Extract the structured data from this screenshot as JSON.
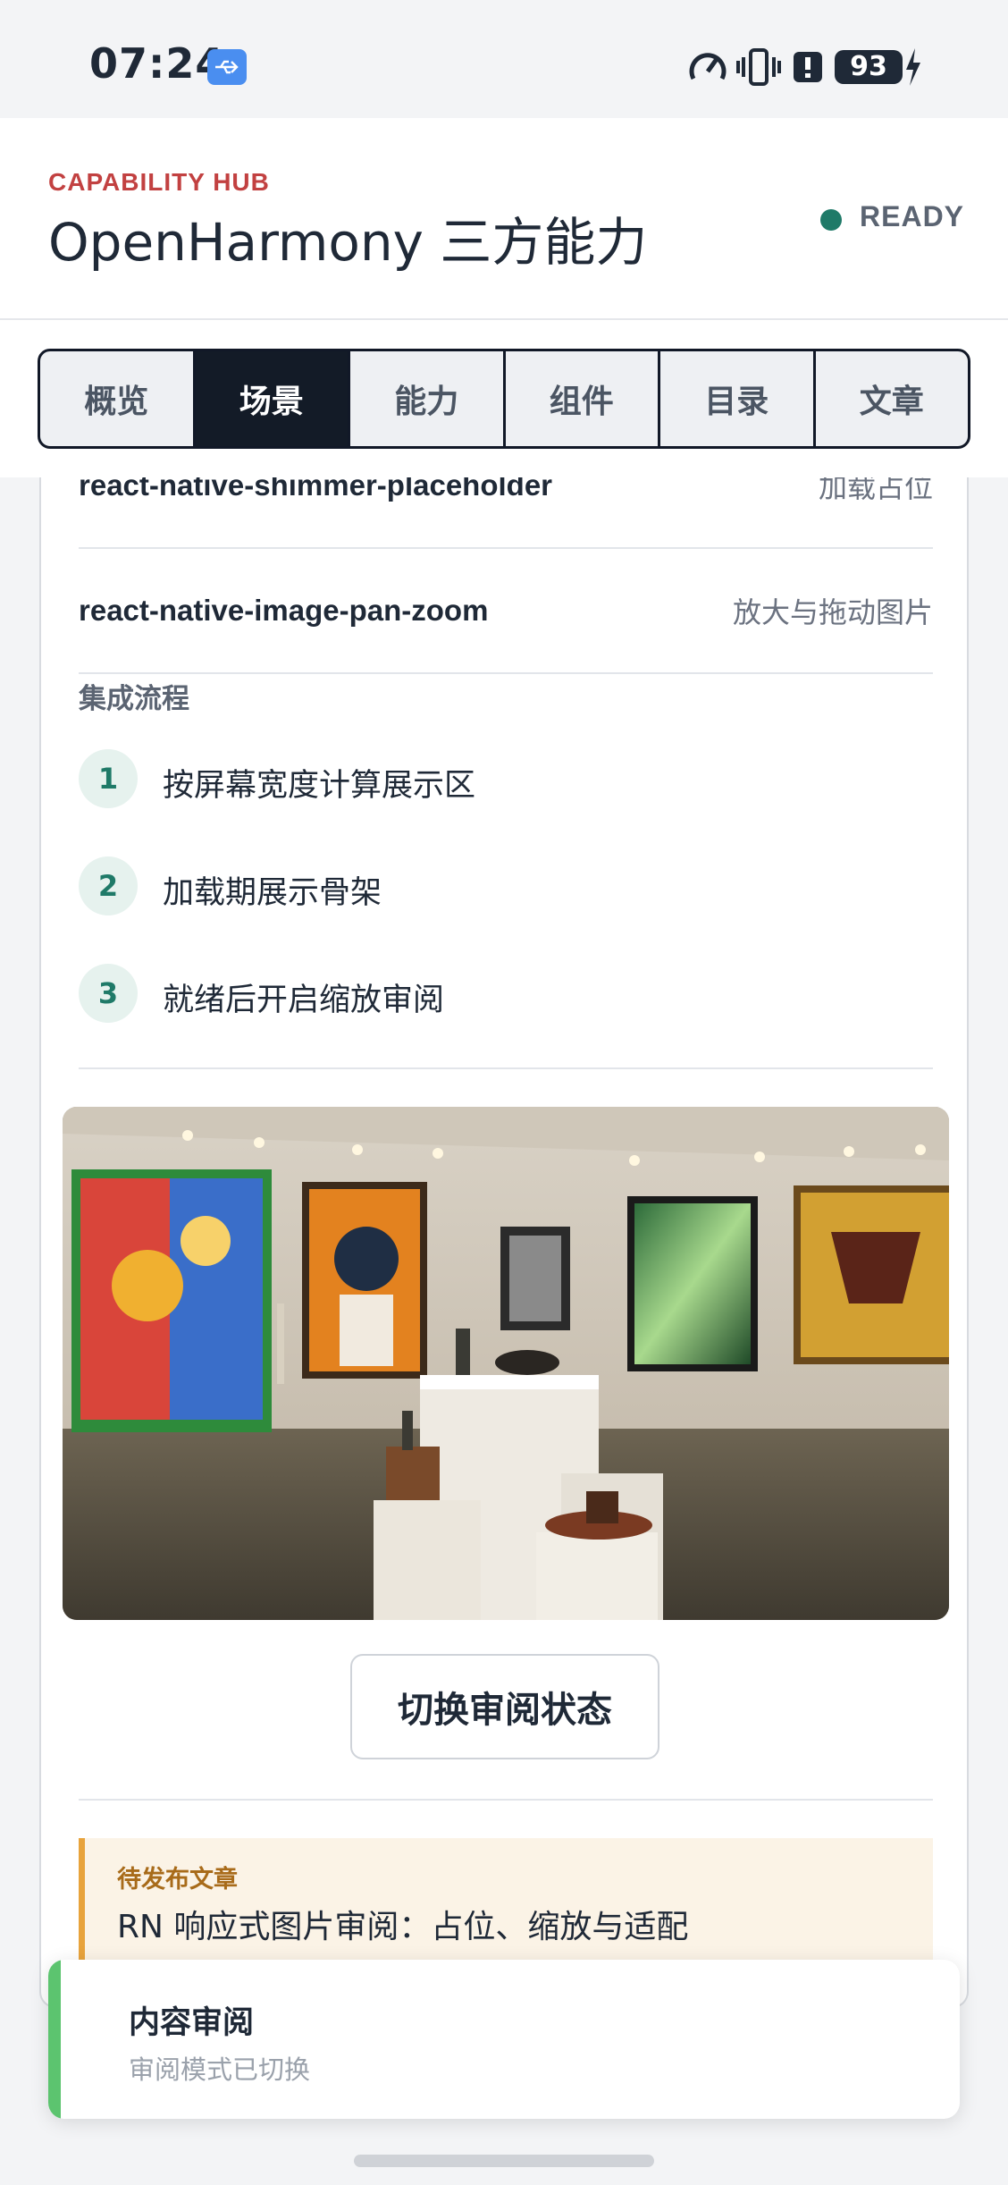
{
  "status_bar": {
    "time": "07:24",
    "battery": "93",
    "icons": [
      "usb-icon",
      "data-saver-icon",
      "vibrate-icon",
      "alert-icon",
      "battery-icon",
      "charging-icon"
    ]
  },
  "header": {
    "eyebrow": "CAPABILITY HUB",
    "title": "OpenHarmony 三方能力",
    "status": "READY",
    "status_color": "#1f7a68",
    "eyebrow_color": "#c24141"
  },
  "tabs": [
    {
      "label": "概览",
      "active": false
    },
    {
      "label": "场景",
      "active": true
    },
    {
      "label": "能力",
      "active": false
    },
    {
      "label": "组件",
      "active": false
    },
    {
      "label": "目录",
      "active": false
    },
    {
      "label": "文章",
      "active": false
    }
  ],
  "libraries": [
    {
      "name": "react-native-shimmer-placeholder",
      "desc": "加载占位"
    },
    {
      "name": "react-native-image-pan-zoom",
      "desc": "放大与拖动图片"
    }
  ],
  "flow": {
    "title": "集成流程",
    "steps": [
      {
        "num": "1",
        "text": "按屏幕宽度计算展示区"
      },
      {
        "num": "2",
        "text": "加载期展示骨架"
      },
      {
        "num": "3",
        "text": "就绪后开启缩放审阅"
      }
    ]
  },
  "toggle_button": "切换审阅状态",
  "article": {
    "label": "待发布文章",
    "title": "RN 响应式图片审阅：占位、缩放与适配"
  },
  "toast": {
    "title": "内容审阅",
    "subtitle": "审阅模式已切换",
    "accent": "#5cc46f"
  }
}
